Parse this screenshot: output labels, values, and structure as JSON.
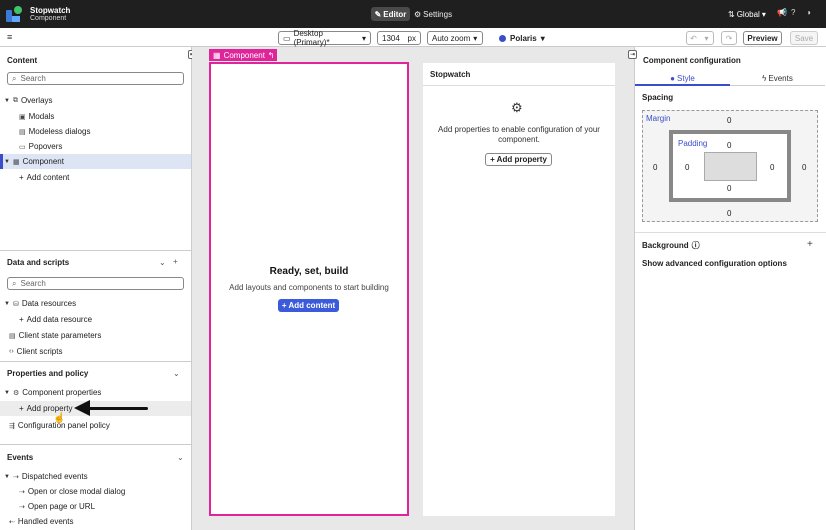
{
  "topbar": {
    "app_title": "Stopwatch",
    "app_subtitle": "Component",
    "editor_label": "Editor",
    "settings_label": "Settings",
    "scope_label": "Global"
  },
  "toolbar": {
    "device_select": "Desktop (Primary)*",
    "width_value": "1304",
    "width_unit": "px",
    "zoom_select": "Auto zoom",
    "theme_label": "Polaris",
    "preview_label": "Preview",
    "save_label": "Save"
  },
  "left": {
    "content": {
      "title": "Content",
      "search_placeholder": "Search",
      "items": {
        "overlays": "Overlays",
        "modals": "Modals",
        "modeless": "Modeless dialogs",
        "popovers": "Popovers",
        "component": "Component",
        "add_content": "Add content"
      }
    },
    "data_scripts": {
      "title": "Data and scripts",
      "search_placeholder": "Search",
      "items": {
        "data_resources": "Data resources",
        "add_data_resource": "Add data resource",
        "client_state": "Client state parameters",
        "client_scripts": "Client scripts"
      }
    },
    "properties": {
      "title": "Properties and policy",
      "items": {
        "component_properties": "Component properties",
        "add_property": "Add property",
        "config_policy": "Configuration panel policy"
      }
    },
    "events": {
      "title": "Events",
      "items": {
        "dispatched": "Dispatched events",
        "open_close_modal": "Open or close modal dialog",
        "open_page": "Open page or URL",
        "handled": "Handled events"
      }
    }
  },
  "canvas": {
    "tag_label": "Component",
    "ready_title": "Ready, set, build",
    "ready_sub": "Add layouts and components to start building",
    "add_content_button": "+ Add content",
    "stopwatch_title": "Stopwatch",
    "stopwatch_msg": "Add properties to enable configuration of your component.",
    "add_property_button": "+ Add property"
  },
  "right": {
    "title": "Component configuration",
    "tab_style": "Style",
    "tab_events": "Events",
    "spacing_title": "Spacing",
    "margin_label": "Margin",
    "padding_label": "Padding",
    "margin": {
      "top": "0",
      "right": "0",
      "bottom": "0",
      "left": "0"
    },
    "padding": {
      "top": "0",
      "right": "0",
      "bottom": "0",
      "left": "0"
    },
    "background_title": "Background",
    "advanced_link": "Show advanced configuration options"
  },
  "colors": {
    "accent": "#3b4ec9",
    "component_magenta": "#e0259a",
    "primary_button": "#3b5bdb",
    "topbar": "#1f1f1f"
  }
}
